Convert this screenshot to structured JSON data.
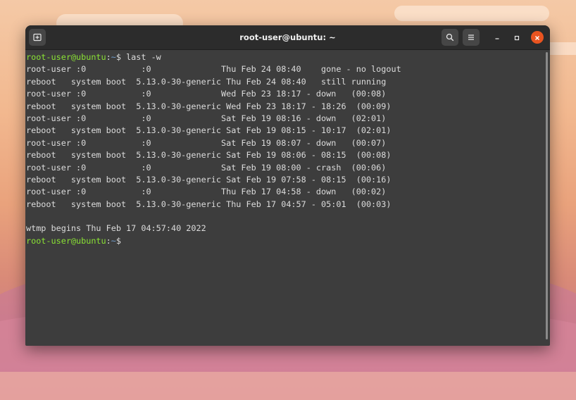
{
  "window": {
    "title": "root-user@ubuntu: ~"
  },
  "prompt": {
    "user_host": "root-user@ubuntu",
    "sep": ":",
    "path": "~",
    "symbol": "$",
    "command": " last -w"
  },
  "output": [
    "root-user :0           :0              Thu Feb 24 08:40    gone - no logout",
    "reboot   system boot  5.13.0-30-generic Thu Feb 24 08:40   still running",
    "root-user :0           :0              Wed Feb 23 18:17 - down   (00:08)",
    "reboot   system boot  5.13.0-30-generic Wed Feb 23 18:17 - 18:26  (00:09)",
    "root-user :0           :0              Sat Feb 19 08:16 - down   (02:01)",
    "reboot   system boot  5.13.0-30-generic Sat Feb 19 08:15 - 10:17  (02:01)",
    "root-user :0           :0              Sat Feb 19 08:07 - down   (00:07)",
    "reboot   system boot  5.13.0-30-generic Sat Feb 19 08:06 - 08:15  (00:08)",
    "root-user :0           :0              Sat Feb 19 08:00 - crash  (00:06)",
    "reboot   system boot  5.13.0-30-generic Sat Feb 19 07:58 - 08:15  (00:16)",
    "root-user :0           :0              Thu Feb 17 04:58 - down   (00:02)",
    "reboot   system boot  5.13.0-30-generic Thu Feb 17 04:57 - 05:01  (00:03)",
    "",
    "wtmp begins Thu Feb 17 04:57:40 2022"
  ],
  "colors": {
    "prompt_user": "#8ae234",
    "prompt_path": "#729fcf",
    "close_button": "#e95420",
    "terminal_bg": "#3d3d3d",
    "titlebar_bg": "#2c2c2c"
  },
  "icons": {
    "new_tab": "new-tab-icon",
    "search": "search-icon",
    "menu": "hamburger-menu-icon",
    "minimize": "minimize-icon",
    "maximize": "maximize-icon",
    "close": "close-icon"
  }
}
